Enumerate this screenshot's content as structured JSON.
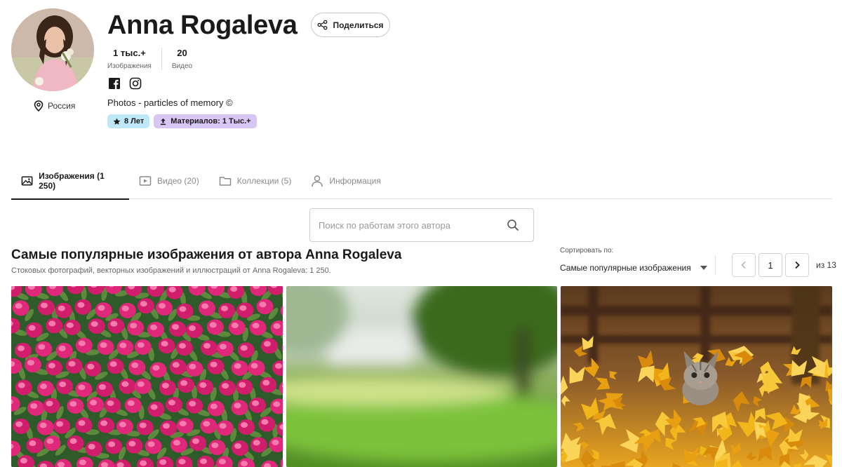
{
  "profile": {
    "name": "Anna Rogaleva",
    "location": "Россия",
    "share_label": "Поделиться",
    "stats": [
      {
        "value": "1 тыс.+",
        "label": "Изображения"
      },
      {
        "value": "20",
        "label": "Видео"
      }
    ],
    "bio": "Photos - particles of memory ©",
    "badges": {
      "years": "8 Лет",
      "uploads": "Материалов: 1 Тыс.+"
    },
    "socials": [
      "facebook-icon",
      "instagram-icon"
    ]
  },
  "tabs": [
    {
      "label": "Изображения (1 250)",
      "icon": "image-icon",
      "active": true
    },
    {
      "label": "Видео (20)",
      "icon": "video-icon",
      "active": false
    },
    {
      "label": "Коллекции (5)",
      "icon": "folder-icon",
      "active": false
    },
    {
      "label": "Информация",
      "icon": "user-icon",
      "active": false
    }
  ],
  "search": {
    "placeholder": "Поиск по работам этого автора"
  },
  "section": {
    "title": "Самые популярные изображения от автора Anna Rogaleva",
    "subtitle": "Стоковых фотографий, векторных изображений и иллюстраций от Anna Rogaleva: 1 250."
  },
  "sort": {
    "label": "Сортировать по:",
    "selected": "Самые популярные изображения"
  },
  "pagination": {
    "current": "1",
    "of_label": "из 13"
  },
  "gallery": [
    {
      "subject": "pink-tulips"
    },
    {
      "subject": "blurred-park"
    },
    {
      "subject": "kitten-in-autumn-leaves"
    }
  ],
  "colors": {
    "badge_years_bg": "#bfe7f7",
    "badge_uploads_bg": "#d8c6f5",
    "active_tab": "#1a1a1a",
    "muted_text": "#8a8a8a"
  }
}
